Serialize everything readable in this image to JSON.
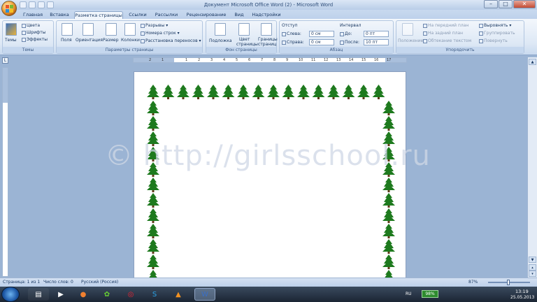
{
  "window": {
    "title": "Документ Microsoft Office Word (2) - Microsoft Word"
  },
  "tabs": [
    "Главная",
    "Вставка",
    "Разметка страницы",
    "Ссылки",
    "Рассылки",
    "Рецензирование",
    "Вид",
    "Надстройки"
  ],
  "active_tab": "Разметка страницы",
  "ribbon": {
    "themes": {
      "label": "Темы",
      "themes_btn": "Темы",
      "colors": "Цвета",
      "fonts": "Шрифты",
      "effects": "Эффекты"
    },
    "page_setup": {
      "label": "Параметры страницы",
      "margins": "Поля",
      "orientation": "Ориентация",
      "size": "Размер",
      "columns": "Колонки",
      "breaks": "Разрывы",
      "line_numbers": "Номера строк",
      "hyphenation": "Расстановка переносов"
    },
    "page_background": {
      "label": "Фон страницы",
      "watermark": "Подложка",
      "page_color_1": "Цвет",
      "page_color_2": "страницы",
      "page_borders_1": "Границы",
      "page_borders_2": "страниц"
    },
    "paragraph": {
      "label": "Абзац",
      "indent": "Отступ",
      "left": "Слева:",
      "left_val": "0 см",
      "right": "Справа:",
      "right_val": "0 см",
      "spacing": "Интервал",
      "before": "До:",
      "before_val": "0 пт",
      "after": "После:",
      "after_val": "10 пт"
    },
    "arrange": {
      "label": "Упорядочить",
      "position": "Положение",
      "bring_front": "На передний план",
      "send_back": "На задний план",
      "text_wrap": "Обтекание текстом",
      "align": "Выровнять",
      "group": "Группировать",
      "rotate": "Повернуть"
    }
  },
  "ruler_numbers": [
    "2",
    "1",
    "1",
    "2",
    "3",
    "4",
    "5",
    "6",
    "7",
    "8",
    "9",
    "10",
    "11",
    "12",
    "13",
    "14",
    "15",
    "16",
    "17"
  ],
  "document": {
    "watermark": "© http://girlsschool.ru",
    "border_color": "#1e7a1e"
  },
  "status": {
    "page": "Страница: 1 из 1",
    "words": "Число слов: 0",
    "language": "Русский (Россия)",
    "zoom": "87%"
  },
  "taskbar": {
    "lang": "RU",
    "battery": "98%",
    "time": "13:19",
    "date": "25.05.2013"
  }
}
